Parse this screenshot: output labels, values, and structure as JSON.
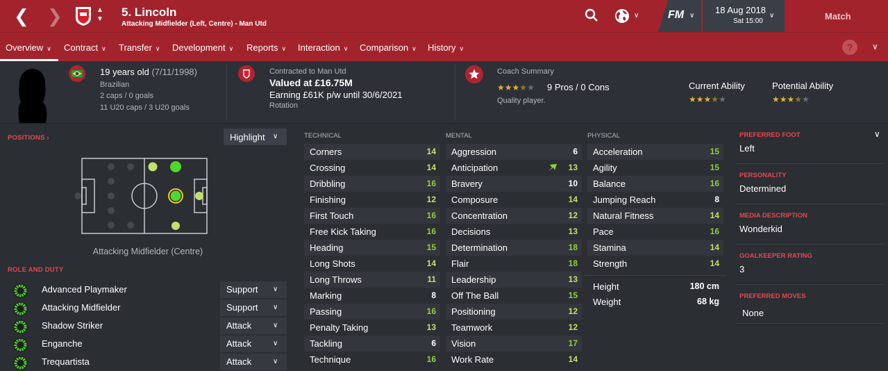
{
  "header": {
    "player_name": "5. Lincoln",
    "player_subtitle": "Attacking Midfielder (Left, Centre) - Man Utd",
    "game_label": "FM",
    "date": "18 Aug 2018",
    "time": "Sat 15:00",
    "match_label": "Match",
    "help_label": "?"
  },
  "tabs": [
    {
      "label": "Overview"
    },
    {
      "label": "Contract"
    },
    {
      "label": "Transfer"
    },
    {
      "label": "Development"
    },
    {
      "label": "Reports"
    },
    {
      "label": "Interaction"
    },
    {
      "label": "Comparison"
    },
    {
      "label": "History"
    }
  ],
  "info": {
    "age": "19 years old",
    "dob": "(7/11/1998)",
    "nationality": "Brazilian",
    "caps": "2 caps / 0 goals",
    "u20_caps": "11 U20 caps / 3 U20 goals",
    "contracted_to": "Contracted to Man Utd",
    "valued_at": "Valued at £16.75M",
    "earning": "Earning £61K p/w until 30/6/2021",
    "squad_status": "Rotation",
    "coach_summary_label": "Coach Summary",
    "pros_cons": "9 Pros / 0 Cons",
    "coach_comment": "Quality player.",
    "coach_stars": 3.5,
    "current_ability_label": "Current Ability",
    "current_ability_stars": 3.5,
    "potential_ability_label": "Potential Ability",
    "potential_ability_stars": 3.5
  },
  "positions": {
    "header": "POSITIONS",
    "highlight_label": "Highlight",
    "selected_position": "Attacking Midfielder (Centre)"
  },
  "roles": {
    "header": "ROLE AND DUTY",
    "items": [
      {
        "name": "Advanced Playmaker",
        "duty": "Support"
      },
      {
        "name": "Attacking Midfielder",
        "duty": "Support"
      },
      {
        "name": "Shadow Striker",
        "duty": "Attack"
      },
      {
        "name": "Enganche",
        "duty": "Attack"
      },
      {
        "name": "Trequartista",
        "duty": "Attack"
      }
    ]
  },
  "attributes": {
    "technical_header": "TECHNICAL",
    "mental_header": "MENTAL",
    "physical_header": "PHYSICAL",
    "technical": [
      {
        "name": "Corners",
        "value": "14"
      },
      {
        "name": "Crossing",
        "value": "14"
      },
      {
        "name": "Dribbling",
        "value": "16"
      },
      {
        "name": "Finishing",
        "value": "12"
      },
      {
        "name": "First Touch",
        "value": "16"
      },
      {
        "name": "Free Kick Taking",
        "value": "16"
      },
      {
        "name": "Heading",
        "value": "15"
      },
      {
        "name": "Long Shots",
        "value": "14"
      },
      {
        "name": "Long Throws",
        "value": "11"
      },
      {
        "name": "Marking",
        "value": "8"
      },
      {
        "name": "Passing",
        "value": "16"
      },
      {
        "name": "Penalty Taking",
        "value": "13"
      },
      {
        "name": "Tackling",
        "value": "6"
      },
      {
        "name": "Technique",
        "value": "16"
      }
    ],
    "mental": [
      {
        "name": "Aggression",
        "value": "6"
      },
      {
        "name": "Anticipation",
        "value": "13"
      },
      {
        "name": "Bravery",
        "value": "10"
      },
      {
        "name": "Composure",
        "value": "14"
      },
      {
        "name": "Concentration",
        "value": "12"
      },
      {
        "name": "Decisions",
        "value": "13"
      },
      {
        "name": "Determination",
        "value": "18"
      },
      {
        "name": "Flair",
        "value": "18"
      },
      {
        "name": "Leadership",
        "value": "13"
      },
      {
        "name": "Off The Ball",
        "value": "15"
      },
      {
        "name": "Positioning",
        "value": "12"
      },
      {
        "name": "Teamwork",
        "value": "12"
      },
      {
        "name": "Vision",
        "value": "17"
      },
      {
        "name": "Work Rate",
        "value": "14"
      }
    ],
    "physical": [
      {
        "name": "Acceleration",
        "value": "15"
      },
      {
        "name": "Agility",
        "value": "15"
      },
      {
        "name": "Balance",
        "value": "16"
      },
      {
        "name": "Jumping Reach",
        "value": "8"
      },
      {
        "name": "Natural Fitness",
        "value": "14"
      },
      {
        "name": "Pace",
        "value": "16"
      },
      {
        "name": "Stamina",
        "value": "14"
      },
      {
        "name": "Strength",
        "value": "14"
      }
    ],
    "height_label": "Height",
    "height_value": "180 cm",
    "weight_label": "Weight",
    "weight_value": "68 kg"
  },
  "profile": {
    "preferred_foot_label": "PREFERRED FOOT",
    "preferred_foot": "Left",
    "personality_label": "PERSONALITY",
    "personality": "Determined",
    "media_description_label": "MEDIA DESCRIPTION",
    "media_description": "Wonderkid",
    "goalkeeper_rating_label": "GOALKEEPER RATING",
    "goalkeeper_rating": "3",
    "preferred_moves_label": "PREFERRED MOVES",
    "preferred_moves": "None"
  },
  "colors": {
    "brand_red": "#a3232d",
    "attr_green": "#8fd13a",
    "attr_lightgreen": "#c3e06b",
    "attr_white": "#ffffff",
    "star_gold": "#e0b431"
  }
}
